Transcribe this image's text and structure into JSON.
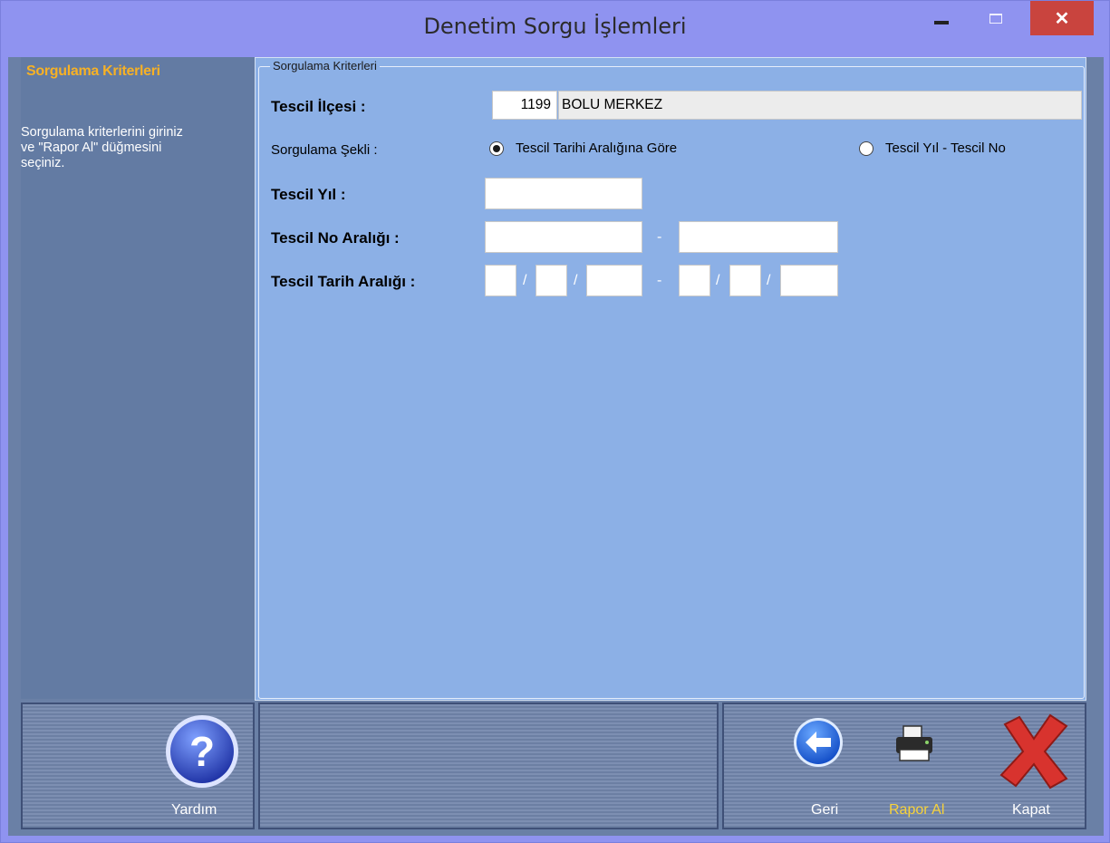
{
  "window": {
    "title": "Denetim Sorgu İşlemleri"
  },
  "left_panel": {
    "heading": "Sorgulama Kriterleri",
    "help_lines": [
      "Sorgulama kriterlerini giriniz",
      "ve \"Rapor Al\" düğmesini",
      "seçiniz."
    ]
  },
  "criteria": {
    "group_label": "Sorgulama Kriterleri",
    "tescil_ilcesi_label": "Tescil İlçesi :",
    "ilce_code": "1199",
    "ilce_name": "BOLU MERKEZ",
    "sorgulama_sekli_label": "Sorgulama Şekli :",
    "option_date_range": "Tescil Tarihi Aralığına Göre",
    "option_year_no": "Tescil Yıl - Tescil No",
    "selected_option": "option_date_range",
    "tescil_yil_label": "Tescil Yıl :",
    "tescil_yil_value": "",
    "tescil_no_label": "Tescil No Aralığı :",
    "tescil_no_from": "",
    "tescil_no_to": "",
    "range_separator": "-",
    "tescil_tarih_label": "Tescil Tarih Aralığı :",
    "date_separator": "/",
    "date_from": {
      "day": "",
      "month": "",
      "year": ""
    },
    "date_to": {
      "day": "",
      "month": "",
      "year": ""
    }
  },
  "toolbar": {
    "help_label": "Yardım",
    "back_label": "Geri",
    "report_label": "Rapor Al",
    "close_label": "Kapat"
  },
  "icons": {
    "help": "question-icon",
    "back": "back-arrow-icon",
    "report": "printer-icon",
    "close": "red-x-icon"
  },
  "colors": {
    "accent_heading": "#f7b125",
    "report_label": "#f7d23a",
    "panel_blue": "#8cb0e6",
    "close_red": "#c9443e"
  }
}
